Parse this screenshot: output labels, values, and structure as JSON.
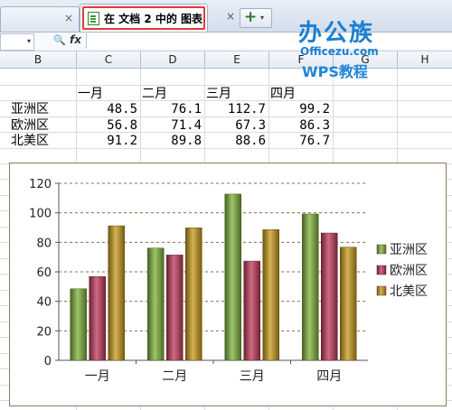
{
  "tabs": {
    "prev_close": "×",
    "active_label": "在 文档 2 中的 图表",
    "active_close": "×",
    "add_label": "+",
    "add_dropdown": "▾"
  },
  "logo": {
    "main": "办公族",
    "url": "Officezu.com",
    "wps": "WPS教程"
  },
  "formula_bar": {
    "namebox_value": "",
    "zoom_glyph": "🔍",
    "fx_label": "fx",
    "formula_value": ""
  },
  "columns": [
    "B",
    "C",
    "D",
    "E",
    "F",
    "G",
    "H"
  ],
  "table": {
    "headers": [
      "一月",
      "二月",
      "三月",
      "四月"
    ],
    "rows": [
      {
        "label": "亚洲区",
        "values": [
          "48.5",
          "76.1",
          "112.7",
          "99.2"
        ]
      },
      {
        "label": "欧洲区",
        "values": [
          "56.8",
          "71.4",
          "67.3",
          "86.3"
        ]
      },
      {
        "label": "北美区",
        "values": [
          "91.2",
          "89.8",
          "88.6",
          "76.7"
        ]
      }
    ]
  },
  "chart_data": {
    "type": "bar",
    "categories": [
      "一月",
      "二月",
      "三月",
      "四月"
    ],
    "series": [
      {
        "name": "亚洲区",
        "values": [
          48.5,
          76.1,
          112.7,
          99.2
        ],
        "color": "#7fb13a"
      },
      {
        "name": "欧洲区",
        "values": [
          56.8,
          71.4,
          67.3,
          86.3
        ],
        "color": "#c13a5a"
      },
      {
        "name": "北美区",
        "values": [
          91.2,
          89.8,
          88.6,
          76.7
        ],
        "color": "#c89a1a"
      }
    ],
    "y_ticks": [
      "0",
      "20",
      "40",
      "60",
      "80",
      "100",
      "120"
    ],
    "ylim": [
      0,
      120
    ],
    "grid": true,
    "legend_position": "right"
  }
}
